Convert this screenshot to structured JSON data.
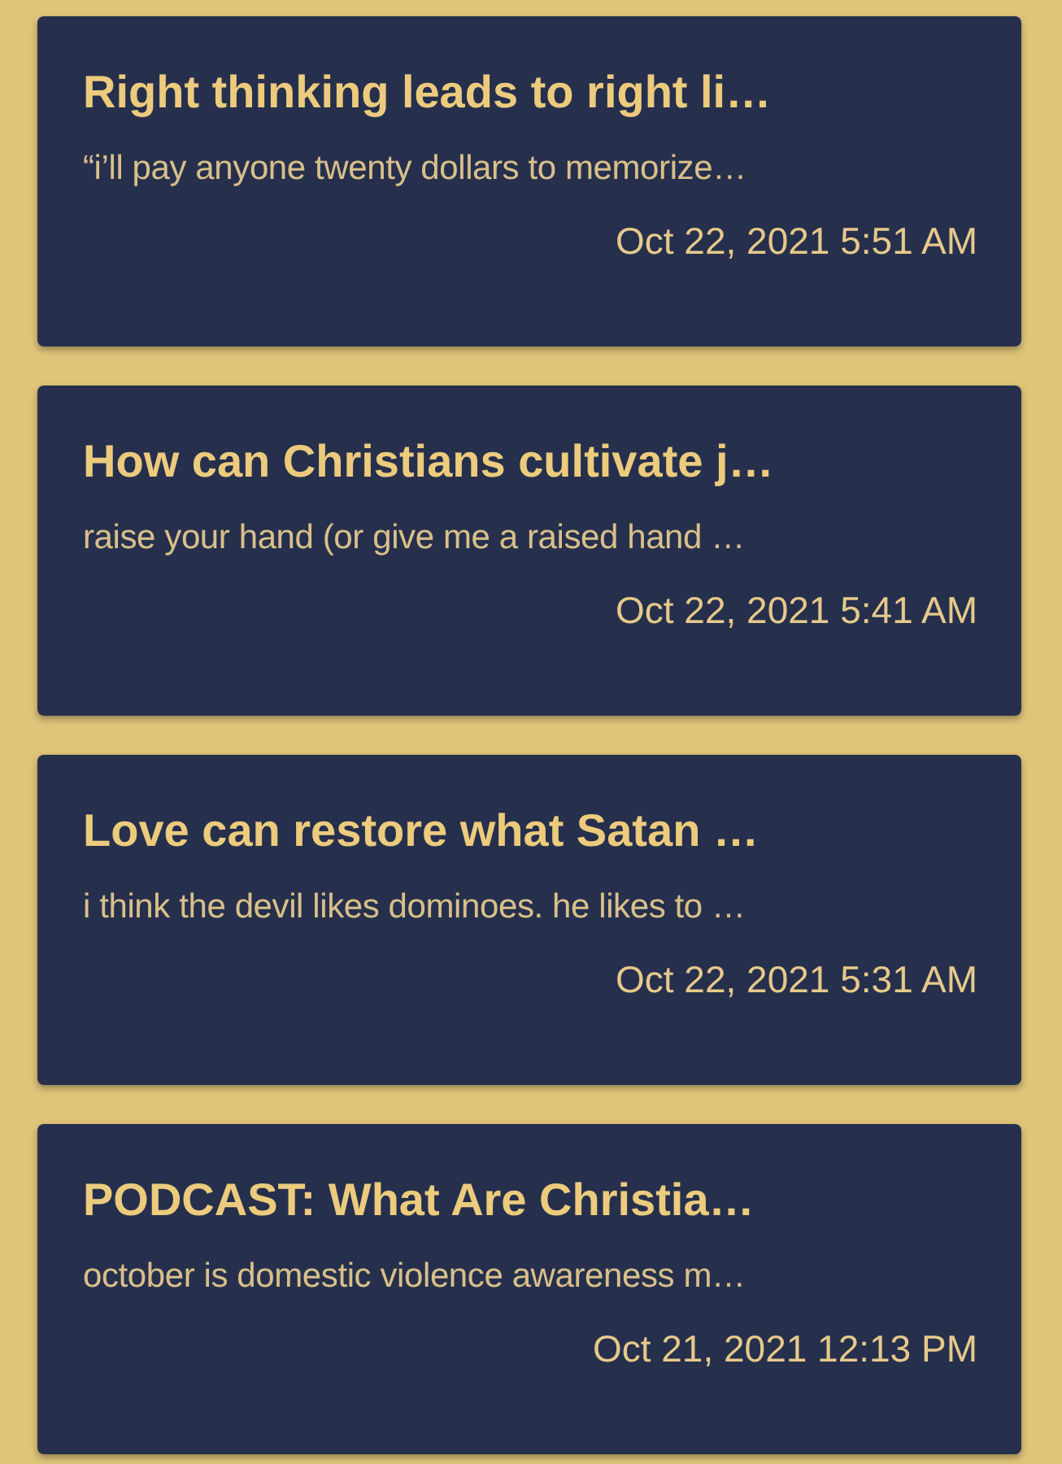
{
  "posts": [
    {
      "title": "Right thinking leads to right li…",
      "excerpt": "“i’ll pay anyone twenty dollars to memorize…",
      "date": "Oct 22, 2021 5:51 AM"
    },
    {
      "title": "How can Christians cultivate j…",
      "excerpt": "raise your hand (or give me a raised hand …",
      "date": "Oct 22, 2021 5:41 AM"
    },
    {
      "title": "Love can restore what Satan …",
      "excerpt": "i think the devil likes dominoes. he likes to …",
      "date": "Oct 22, 2021 5:31 AM"
    },
    {
      "title": "PODCAST: What Are Christia…",
      "excerpt": "october is domestic violence awareness m…",
      "date": "Oct 21, 2021 12:13 PM"
    }
  ]
}
